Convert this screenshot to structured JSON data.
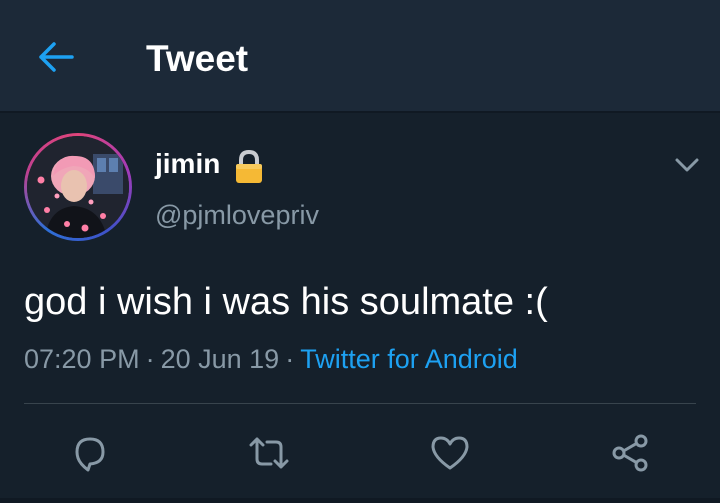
{
  "header": {
    "back_icon": "back-arrow-icon",
    "title": "Tweet"
  },
  "tweet": {
    "display_name": "jimin",
    "protected_icon": "lock-icon",
    "handle": "@pjmlovepriv",
    "text": "god i wish i was his soulmate :(",
    "time": "07:20 PM",
    "date": "20 Jun 19",
    "separator": "·",
    "source": "Twitter for Android",
    "menu_icon": "chevron-down-icon"
  },
  "actions": [
    {
      "icon": "reply-icon"
    },
    {
      "icon": "retweet-icon"
    },
    {
      "icon": "like-icon"
    },
    {
      "icon": "share-icon"
    }
  ],
  "colors": {
    "background": "#15202b",
    "header": "#1c2938",
    "text": "#ffffff",
    "muted": "#8899a6",
    "accent": "#1da1f2",
    "lock": "#f5b935"
  }
}
